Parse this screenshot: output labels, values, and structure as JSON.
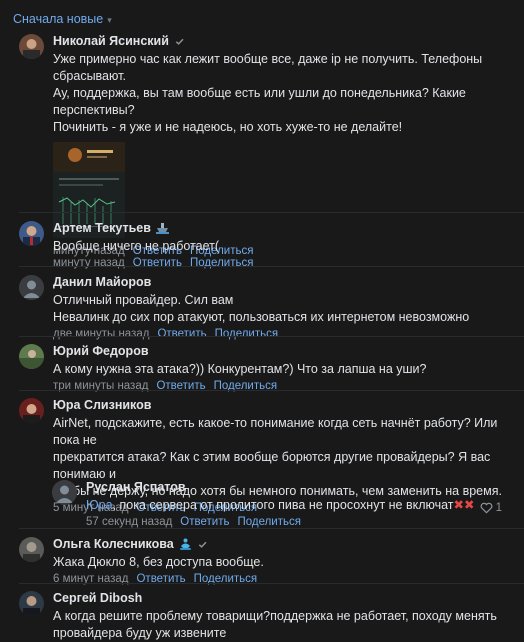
{
  "sort": {
    "label": "Сначала новые"
  },
  "actions": {
    "reply": "Ответить",
    "share": "Поделиться"
  },
  "comments": [
    {
      "name": "Николай Ясинский",
      "badge": "verified-check",
      "lines": [
        "Уже примерно час как лежит вообще все, даже ip не получить. Телефоны сбрасывают.",
        "Ау, поддержка, вы там вообще есть или ушли до понедельника? Какие перспективы?",
        "Починить - я уже и не надеюсь, но хоть хуже-то не делайте!"
      ],
      "time": "минуту назад"
    },
    {
      "name": "Артем Текутьев",
      "badge": "ship-emoji",
      "lines": [
        "Вообще ничего не работает("
      ],
      "time": "минуту назад"
    },
    {
      "name": "Данил Майоров",
      "lines": [
        "Отличный провайдер. Сил вам",
        "Невалинк до сих пор атакуют, пользоваться их интернетом невозможно"
      ],
      "time": "две минуты назад"
    },
    {
      "name": "Юрий Федоров",
      "lines": [
        "А кому нужна эта атака?)) Конкурентам?) Что за лапша на уши?"
      ],
      "time": "три минуты назад"
    },
    {
      "name": "Юра Слизников",
      "lines": [
        "AirNet, подскажите, есть какое-то понимание когда сеть начнёт работу? Или пока не",
        "прекратится атака? Как с этим вообще борются другие провайдеры? Я вас понимаю и",
        "злобы не держу, но надо хотя бы немного понимать, чем заменить на время."
      ],
      "time": "5 минут назад",
      "likes": "1"
    },
    {
      "name": "Руслан Яспатов",
      "mention": "Юра",
      "text": ", пока сервера от пролитого пива не просохнут не включат",
      "marks": "✖✖",
      "time": "57 секунд назад"
    },
    {
      "name": "Ольга Колесникова",
      "badge": "meditation-emoji",
      "lines": [
        "Жака Дюкло 8, без доступа вообще."
      ],
      "time": "6 минут назад"
    },
    {
      "name": "Сергей Dibosh",
      "lines": [
        "А когда решите проблему товарищи?поддержка не работает, походу менять",
        "провайдера буду уж извените"
      ]
    }
  ],
  "colors": {
    "background": "#19191a",
    "link": "#71aaeb",
    "text": "#e1e3e6",
    "muted": "#8d9399"
  }
}
